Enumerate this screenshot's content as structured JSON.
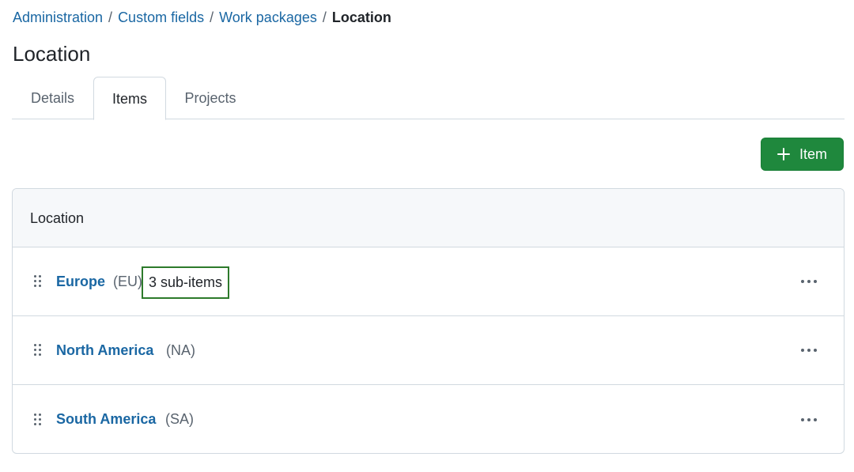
{
  "breadcrumb": {
    "items": [
      "Administration",
      "Custom fields",
      "Work packages"
    ],
    "separator": "/",
    "current": "Location"
  },
  "page_title": "Location",
  "tabs": [
    {
      "label": "Details",
      "active": false
    },
    {
      "label": "Items",
      "active": true
    },
    {
      "label": "Projects",
      "active": false
    }
  ],
  "add_button": {
    "label": "Item",
    "icon": "plus-icon",
    "color": "#1f883d"
  },
  "list": {
    "header": "Location",
    "items": [
      {
        "name": "Europe",
        "short": "(EU)",
        "sub_items": "3 sub-items"
      },
      {
        "name": "North America",
        "short": "(NA)"
      },
      {
        "name": "South America",
        "short": "(SA)"
      }
    ]
  },
  "colors": {
    "link": "#1a67a3",
    "highlight_border": "#2d7a2b"
  }
}
